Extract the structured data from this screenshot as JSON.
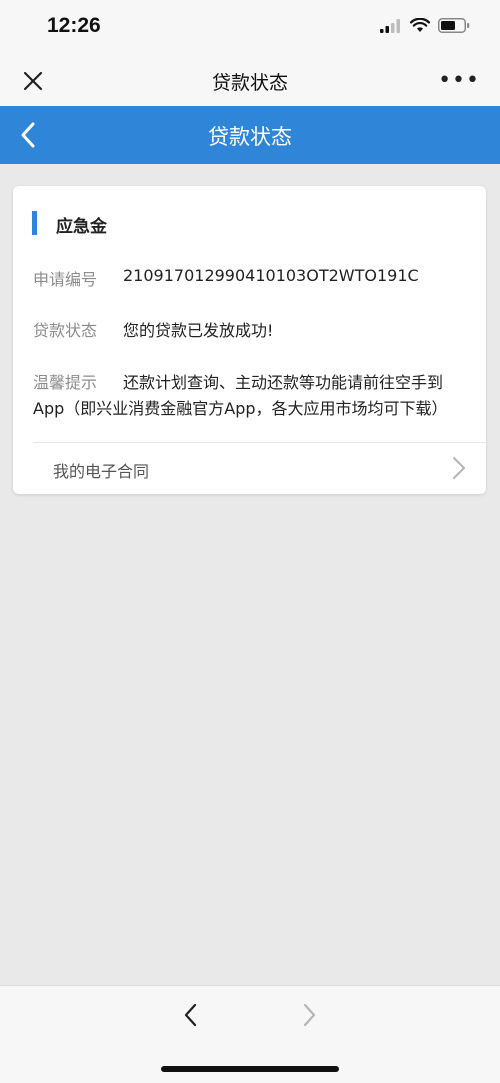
{
  "status_bar": {
    "time": "12:26",
    "icons": [
      "cellular-signal-icon",
      "wifi-icon",
      "battery-icon"
    ]
  },
  "wechat_bar": {
    "title": "贷款状态",
    "close_icon": "close-icon",
    "more_label": "•••"
  },
  "app_header": {
    "title": "贷款状态",
    "back_icon": "chevron-left-icon",
    "bg_color": "#2f86d8"
  },
  "card": {
    "title": "应急金",
    "rows": [
      {
        "label": "申请编号",
        "value": "21091701299041010 3OT2WTO191C"
      },
      {
        "label": "贷款状态",
        "value": "您的贷款已发放成功!"
      },
      {
        "label": "温馨提示",
        "value": "还款计划查询、主动还款等功能请前往空手到"
      }
    ],
    "tip_continuation": "App（即兴业消费金融官方App，各大应用市场均可下载）",
    "contract_link": "我的电子合同"
  },
  "bottom_nav": {
    "back_icon": "chevron-left-icon",
    "forward_icon": "chevron-right-icon"
  },
  "colors": {
    "accent": "#2f86d8",
    "page_bg": "#e9e9e9"
  }
}
